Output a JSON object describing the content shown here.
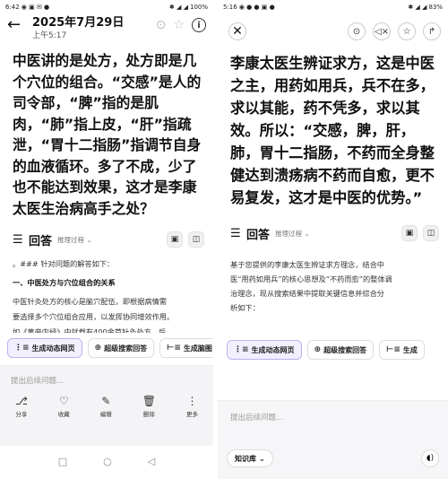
{
  "left": {
    "status": {
      "time": "6:42",
      "battery": "100%"
    },
    "header": {
      "date": "2025年7月29日",
      "time": "上午5:17"
    },
    "quote": "中医讲的是处方，处方即是几个穴位的组合。“交感”是人的司令部，“脾”指的是肌肉，“肺”指上皮，“肝”指疏泄，“胃十二指肠”指调节自身的血液循环。多了不成，少了也不能达到效果，这才是李康太医生治病高手之处？",
    "answer": {
      "label": "回答",
      "process": "推理过程"
    },
    "lines": [
      "。### 针对问题的解答如下：",
      "一、中医处方与穴位组合的关系",
      "中医针灸处方的核心是腧穴配伍，即根据病情需",
      "要选择多个穴位组合应用，以发挥协同增效作用。",
      "如《黄帝内经》中就载有400余首针灸处方，后"
    ],
    "chips": [
      "生成动态网页",
      "超级搜索回答",
      "生成脑图"
    ],
    "input_placeholder": "提出后续问题...",
    "toolbar": [
      "分享",
      "收藏",
      "编辑",
      "删除",
      "更多"
    ]
  },
  "right": {
    "status": {
      "time": "5:16",
      "battery": "83%"
    },
    "quote": "李康太医生辨证求方，这是中医之主，用药如用兵，兵不在多，求以其能，药不凭多，求以其效。所以：“交感，脾，肝，肺，胃十二指肠，不药而全身整健达到溃疡病不药而自愈，更不易复发，这才是中医的优势。”",
    "answer": {
      "label": "回答",
      "process": "推理过程"
    },
    "lines": [
      "基于您提供的李康太医生辨证求方理念，结合中",
      "医“用药如用兵”的核心思想及“不药而愈”的整体调",
      "治理念，现从搜索结果中提取关键信息并综合分",
      "析如下："
    ],
    "chips": [
      "生成动态网页",
      "超级搜索回答",
      "生成"
    ],
    "input_placeholder": "提出后续问题...",
    "knowledge": "知识库"
  },
  "colors": {
    "chip_primary_bg": "#f2f0ff",
    "chip_primary_border": "#b9b4f0"
  }
}
